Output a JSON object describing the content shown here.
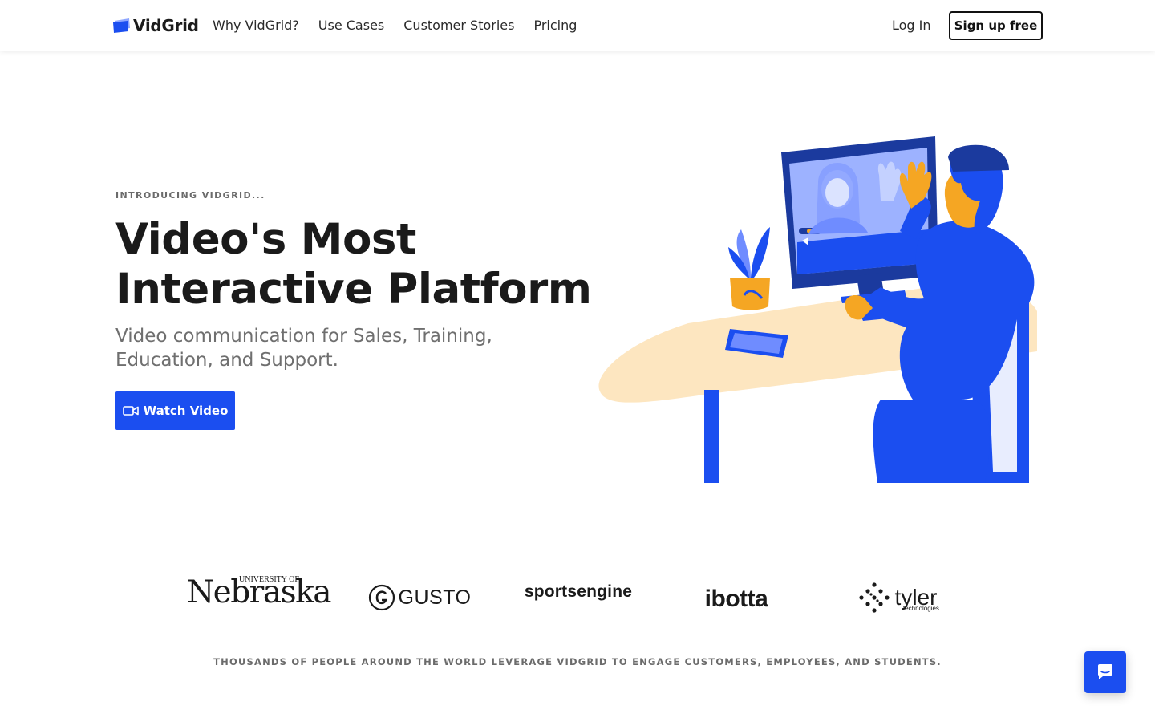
{
  "brand": {
    "name": "VidGrid",
    "accent": "#1b4ef0"
  },
  "nav": {
    "links": [
      "Why VidGrid?",
      "Use Cases",
      "Customer Stories",
      "Pricing"
    ],
    "login": "Log In",
    "signup": "Sign up free"
  },
  "hero": {
    "eyebrow": "INTRODUCING VIDGRID...",
    "headline_line1": "Video's Most",
    "headline_line2": "Interactive Platform",
    "subhead": "Video communication for Sales, Training, Education, and Support.",
    "cta": "Watch Video",
    "cta_icon": "video-camera-icon",
    "illustration": "person-on-video-call-at-desk"
  },
  "customers": {
    "logos": [
      {
        "name": "Nebraska",
        "prefix": "UNIVERSITY OF"
      },
      {
        "name": "GUSTO"
      },
      {
        "name": "sportsengine"
      },
      {
        "name": "ibotta"
      },
      {
        "name": "tyler",
        "sub": "technologies"
      }
    ],
    "tagline": "THOUSANDS OF PEOPLE AROUND THE WORLD LEVERAGE VIDGRID TO ENGAGE CUSTOMERS, EMPLOYEES, AND STUDENTS."
  },
  "chat": {
    "icon": "chat-bubble-icon"
  }
}
